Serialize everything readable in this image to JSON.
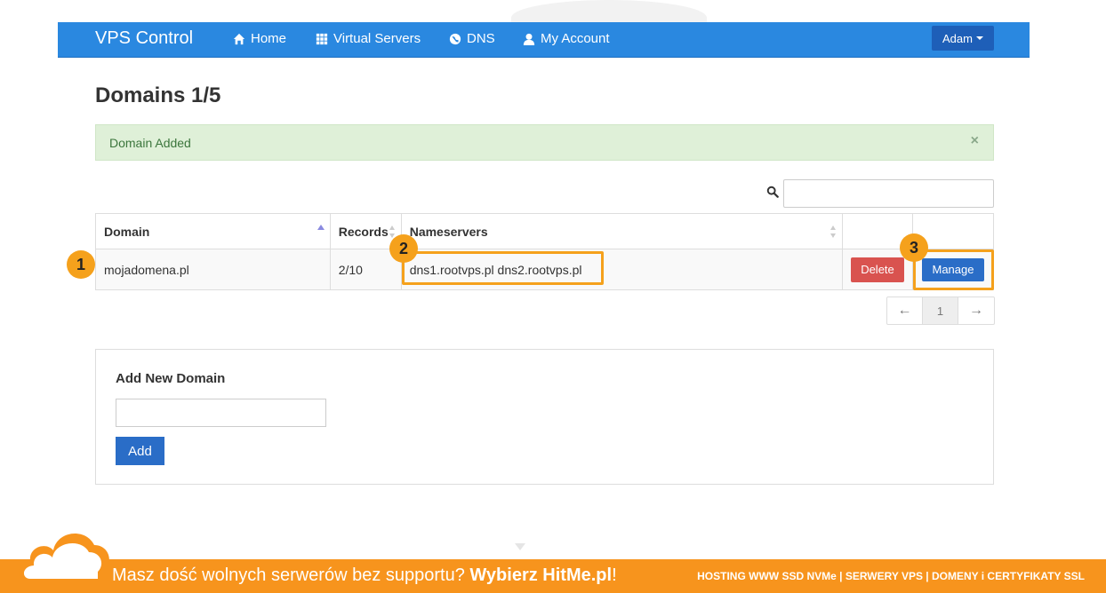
{
  "navbar": {
    "brand": "VPS Control",
    "items": [
      {
        "label": "Home",
        "icon": "home-icon"
      },
      {
        "label": "Virtual Servers",
        "icon": "grid-icon"
      },
      {
        "label": "DNS",
        "icon": "globe-icon"
      },
      {
        "label": "My Account",
        "icon": "user-icon"
      }
    ],
    "user_label": "Adam"
  },
  "page": {
    "title": "Domains 1/5",
    "alert": "Domain Added",
    "alert_close": "×"
  },
  "table": {
    "headers": [
      "Domain",
      "Records",
      "Nameservers"
    ],
    "rows": [
      {
        "domain": "mojadomena.pl",
        "records": "2/10",
        "nameservers": "dns1.rootvps.pl dns2.rootvps.pl",
        "delete_label": "Delete",
        "manage_label": "Manage"
      }
    ]
  },
  "pagination": {
    "prev": "←",
    "current": "1",
    "next": "→"
  },
  "add_domain": {
    "title": "Add New Domain",
    "input_value": "",
    "button_label": "Add"
  },
  "annotations": {
    "badge1": "1",
    "badge2": "2",
    "badge3": "3",
    "color": "#f5a11c"
  },
  "footer": {
    "tagline_prefix": "Masz dość wolnych serwerów bez supportu? ",
    "tagline_brand": "Wybierz HitMe.pl",
    "tagline_suffix": "!",
    "services": "HOSTING WWW SSD NVMe | SERWERY VPS | DOMENY i CERTYFIKATY SSL"
  },
  "colors": {
    "navbar": "#2a88e0",
    "footer": "#f7941d",
    "alert_bg": "#dff0d8",
    "delete": "#d9534f",
    "manage": "#2a6dc7"
  }
}
